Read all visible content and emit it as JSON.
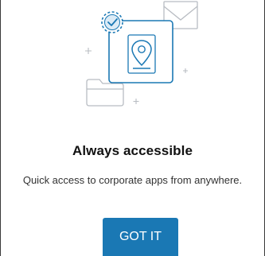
{
  "onboarding": {
    "title": "Always accessible",
    "subtitle": "Quick access to corporate apps from anywhere.",
    "cta_label": "GOT IT"
  },
  "colors": {
    "accent": "#1a78b4",
    "illustration_gray": "#b8bcc2",
    "title_text": "#111111",
    "body_text": "#333333"
  },
  "icons": [
    "check-badge-icon",
    "envelope-icon",
    "location-pin-icon",
    "folder-icon",
    "sparkle-icon"
  ]
}
